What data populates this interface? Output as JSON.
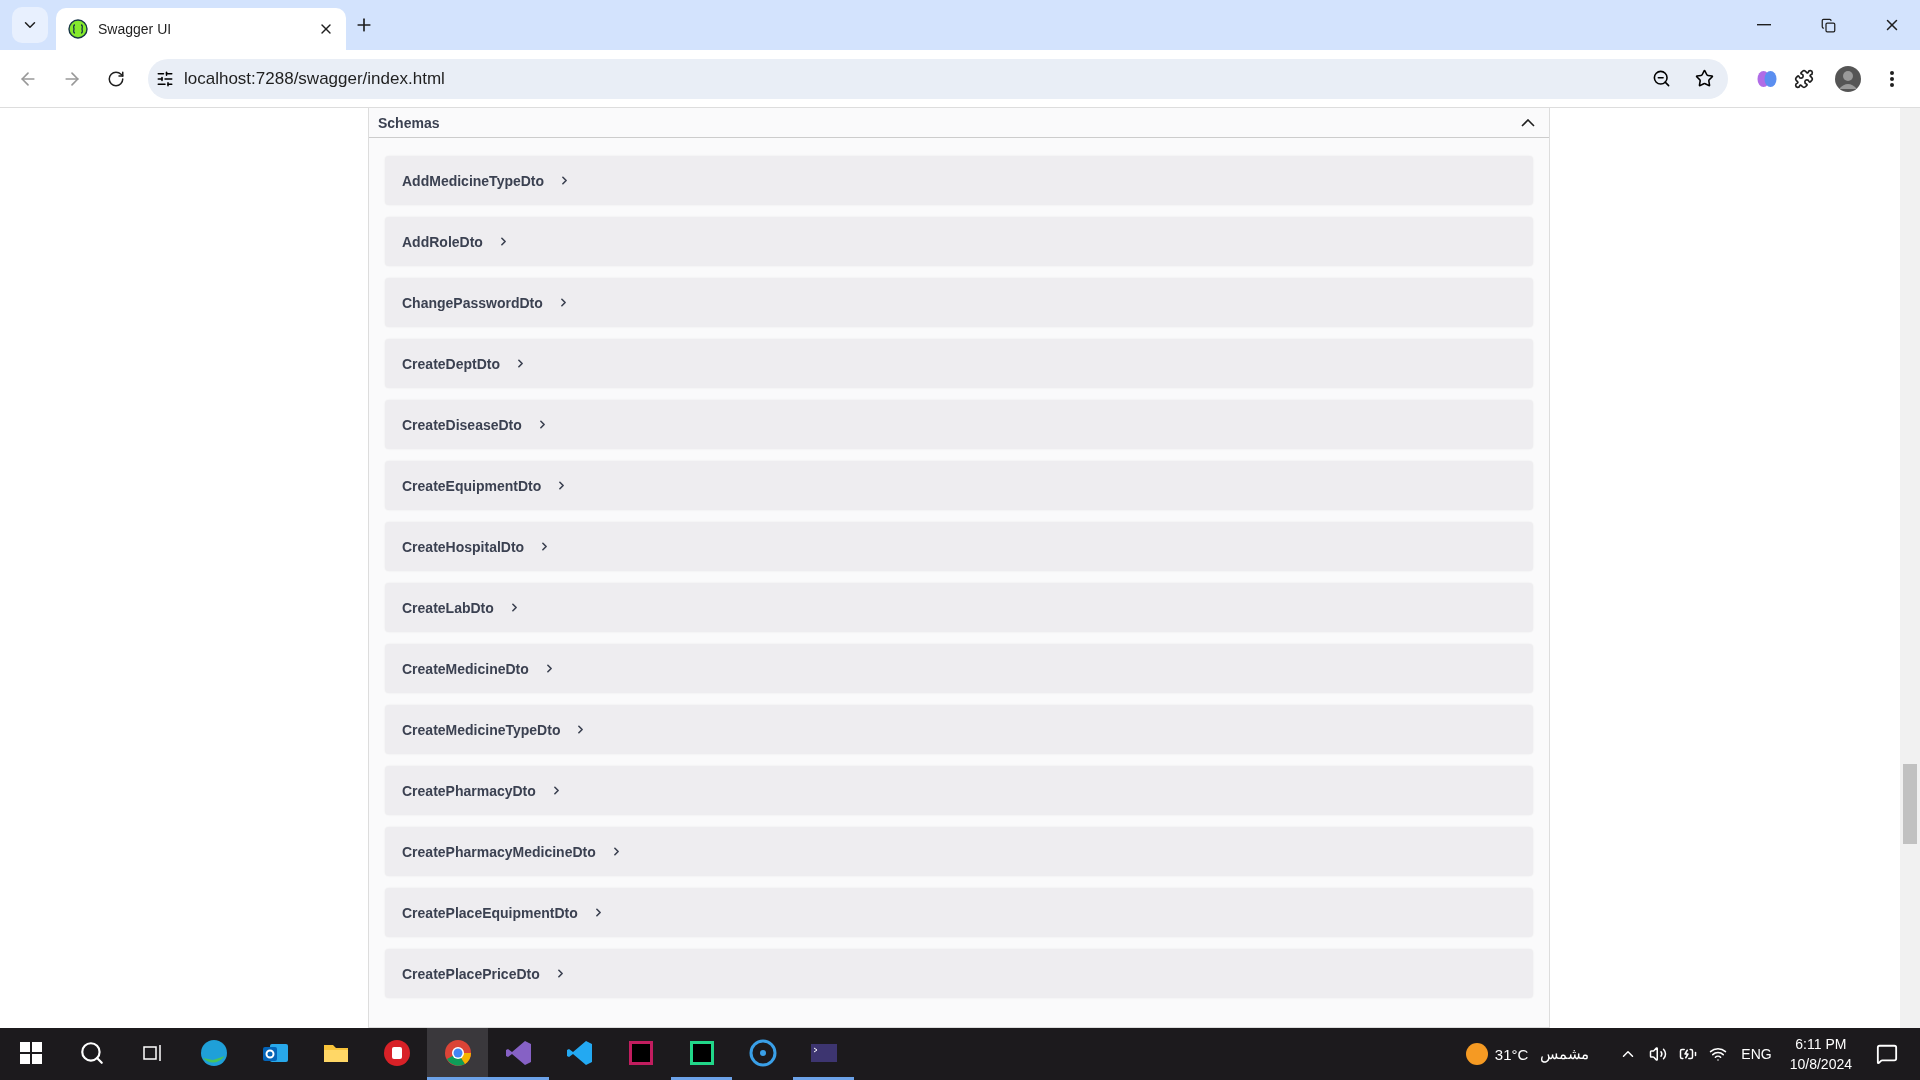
{
  "browser": {
    "tab": {
      "title": "Swagger UI",
      "selected": true
    },
    "url": "localhost:7288/swagger/index.html"
  },
  "section": {
    "title": "Schemas",
    "expanded": true
  },
  "schemas": [
    {
      "name": "AddMedicineTypeDto",
      "expanded": false
    },
    {
      "name": "AddRoleDto",
      "expanded": false
    },
    {
      "name": "ChangePasswordDto",
      "expanded": false
    },
    {
      "name": "CreateDeptDto",
      "expanded": false
    },
    {
      "name": "CreateDiseaseDto",
      "expanded": false
    },
    {
      "name": "CreateEquipmentDto",
      "expanded": false
    },
    {
      "name": "CreateHospitalDto",
      "expanded": false
    },
    {
      "name": "CreateLabDto",
      "expanded": false
    },
    {
      "name": "CreateMedicineDto",
      "expanded": false
    },
    {
      "name": "CreateMedicineTypeDto",
      "expanded": false
    },
    {
      "name": "CreatePharmacyDto",
      "expanded": false
    },
    {
      "name": "CreatePharmacyMedicineDto",
      "expanded": false
    },
    {
      "name": "CreatePlaceEquipmentDto",
      "expanded": false
    },
    {
      "name": "CreatePlacePriceDto",
      "expanded": false
    }
  ],
  "taskbar": {
    "apps": [
      {
        "kind": "edge",
        "selected": false,
        "running": false
      },
      {
        "kind": "outlook",
        "selected": false,
        "running": false
      },
      {
        "kind": "folder",
        "selected": false,
        "running": false
      },
      {
        "kind": "red",
        "selected": false,
        "running": false
      },
      {
        "kind": "chrome",
        "selected": true,
        "running": true
      },
      {
        "kind": "vs",
        "selected": false,
        "running": true
      },
      {
        "kind": "vscode",
        "selected": false,
        "running": false
      },
      {
        "kind": "rd",
        "selected": false,
        "running": false
      },
      {
        "kind": "ws",
        "selected": false,
        "running": true
      },
      {
        "kind": "media",
        "selected": false,
        "running": false
      },
      {
        "kind": "terminal",
        "selected": false,
        "running": true
      }
    ],
    "weather": {
      "temp": "31°C",
      "condition": "مشمس"
    },
    "language": "ENG",
    "time": "6:11 PM",
    "date": "10/8/2024"
  }
}
